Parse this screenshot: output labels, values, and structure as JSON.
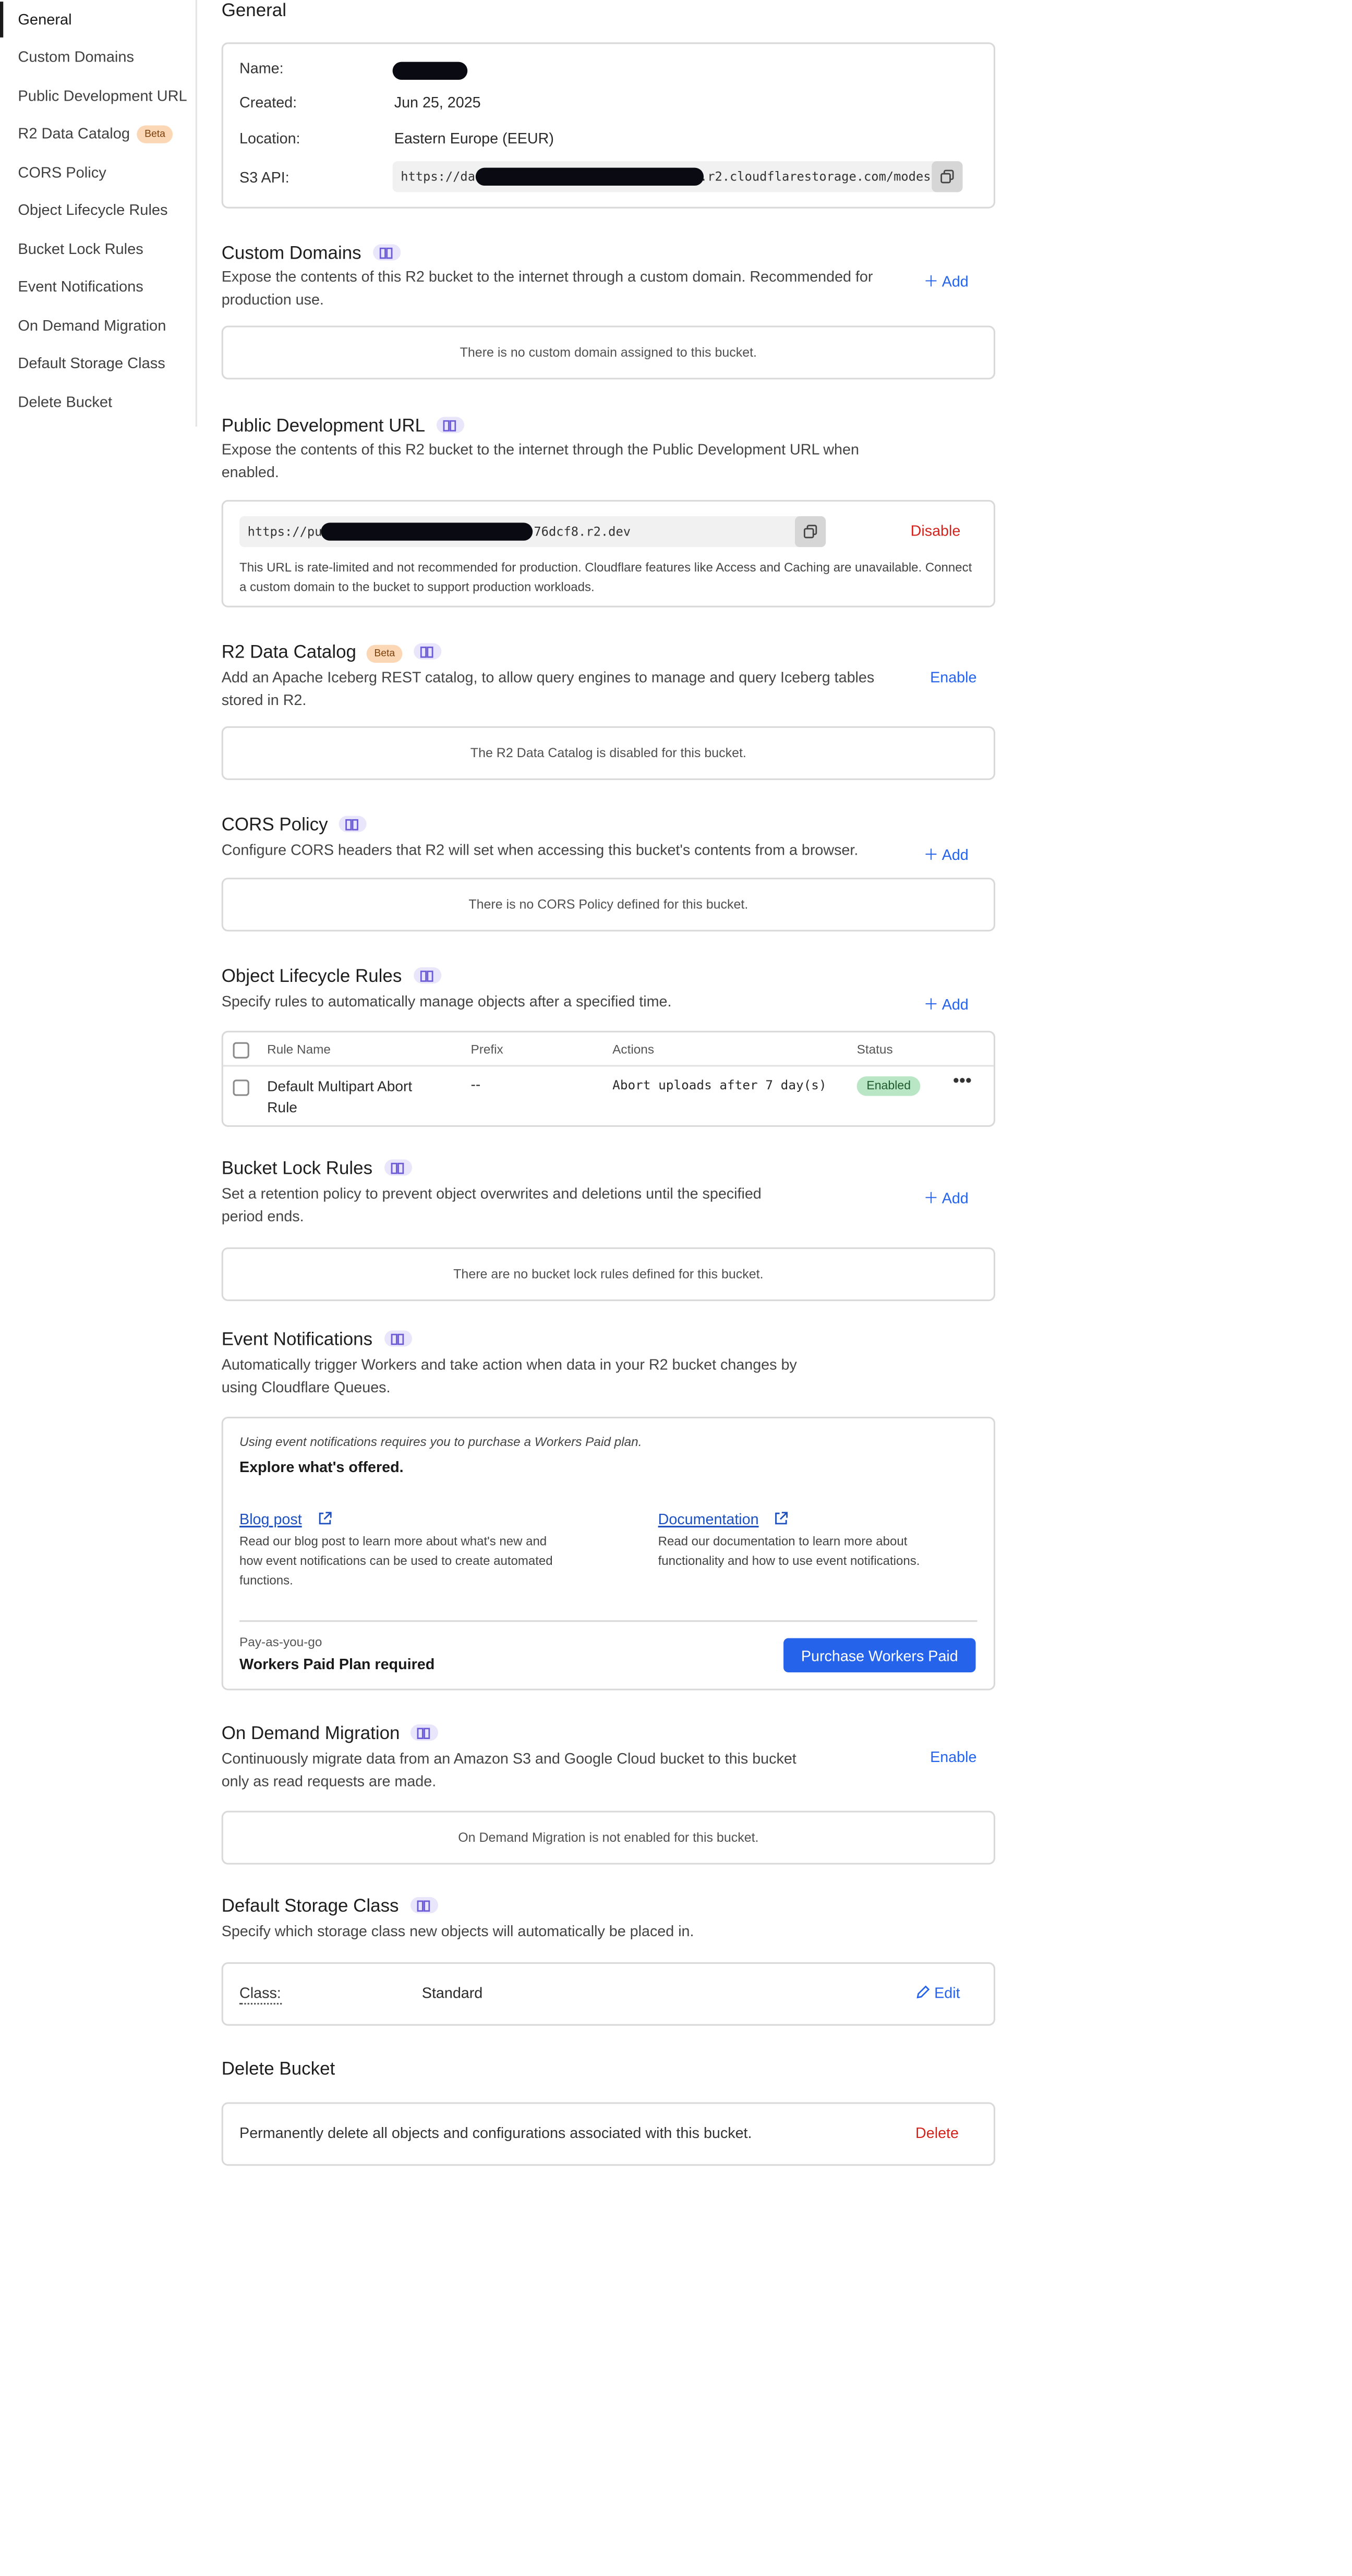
{
  "sidebar": {
    "items": [
      {
        "label": "General",
        "active": true
      },
      {
        "label": "Custom Domains"
      },
      {
        "label": "Public Development URL"
      },
      {
        "label": "R2 Data Catalog",
        "badge": "Beta"
      },
      {
        "label": "CORS Policy"
      },
      {
        "label": "Object Lifecycle Rules"
      },
      {
        "label": "Bucket Lock Rules"
      },
      {
        "label": "Event Notifications"
      },
      {
        "label": "On Demand Migration"
      },
      {
        "label": "Default Storage Class"
      },
      {
        "label": "Delete Bucket"
      }
    ]
  },
  "general": {
    "title": "General",
    "name_label": "Name:",
    "created_label": "Created:",
    "created_value": "Jun 25, 2025",
    "location_label": "Location:",
    "location_value": "Eastern Europe (EEUR)",
    "s3_label": "S3 API:",
    "s3_prefix": "https://da",
    "s3_suffix": ".r2.cloudflarestorage.com/modes"
  },
  "custom_domains": {
    "title": "Custom Domains",
    "description": "Expose the contents of this R2 bucket to the internet through a custom domain. Recommended for production use.",
    "action": "Add",
    "empty": "There is no custom domain assigned to this bucket."
  },
  "public_dev_url": {
    "title": "Public Development URL",
    "description": "Expose the contents of this R2 bucket to the internet through the Public Development URL when enabled.",
    "url_prefix": "https://pu",
    "url_suffix": "76dcf8.r2.dev",
    "action": "Disable",
    "note": "This URL is rate-limited and not recommended for production. Cloudflare features like Access and Caching are unavailable. Connect a custom domain to the bucket to support production workloads."
  },
  "data_catalog": {
    "title": "R2 Data Catalog",
    "badge": "Beta",
    "description": "Add an Apache Iceberg REST catalog, to allow query engines to manage and query Iceberg tables stored in R2.",
    "action": "Enable",
    "empty": "The R2 Data Catalog is disabled for this bucket."
  },
  "cors": {
    "title": "CORS Policy",
    "description": "Configure CORS headers that R2 will set when accessing this bucket's contents from a browser.",
    "action": "Add",
    "empty": "There is no CORS Policy defined for this bucket."
  },
  "lifecycle": {
    "title": "Object Lifecycle Rules",
    "description": "Specify rules to automatically manage objects after a specified time.",
    "action": "Add",
    "columns": [
      "Rule Name",
      "Prefix",
      "Actions",
      "Status"
    ],
    "rows": [
      {
        "name": "Default Multipart Abort Rule",
        "prefix": "--",
        "actions": "Abort uploads after 7 day(s)",
        "status": "Enabled"
      }
    ]
  },
  "bucket_lock": {
    "title": "Bucket Lock Rules",
    "description": "Set a retention policy to prevent object overwrites and deletions until the specified period ends.",
    "action": "Add",
    "empty": "There are no bucket lock rules defined for this bucket."
  },
  "event_notifications": {
    "title": "Event Notifications",
    "description": "Automatically trigger Workers and take action when data in your R2 bucket changes by using Cloudflare Queues.",
    "note": "Using event notifications requires you to purchase a Workers Paid plan.",
    "explore": "Explore what's offered.",
    "blog_link": "Blog post",
    "blog_text": "Read our blog post to learn more about what's new and how event notifications can be used to create automated functions.",
    "docs_link": "Documentation",
    "docs_text": "Read our documentation to learn more about functionality and how to use event notifications.",
    "plan_caption": "Pay-as-you-go",
    "plan_title": "Workers Paid Plan required",
    "purchase_button": "Purchase Workers Paid"
  },
  "migration": {
    "title": "On Demand Migration",
    "description": "Continuously migrate data from an Amazon S3 and Google Cloud bucket to this bucket only as read requests are made.",
    "action": "Enable",
    "empty": "On Demand Migration is not enabled for this bucket."
  },
  "storage_class": {
    "title": "Default Storage Class",
    "description": "Specify which storage class new objects will automatically be placed in.",
    "class_label": "Class:",
    "class_value": "Standard",
    "action": "Edit"
  },
  "delete_bucket": {
    "title": "Delete Bucket",
    "description": "Permanently delete all objects and configurations associated with this bucket.",
    "action": "Delete"
  },
  "colors": {
    "accent": "#2563eb",
    "danger": "#d2241c",
    "success_bg": "#b9e6c4",
    "beta_bg": "#fbd7b5"
  }
}
